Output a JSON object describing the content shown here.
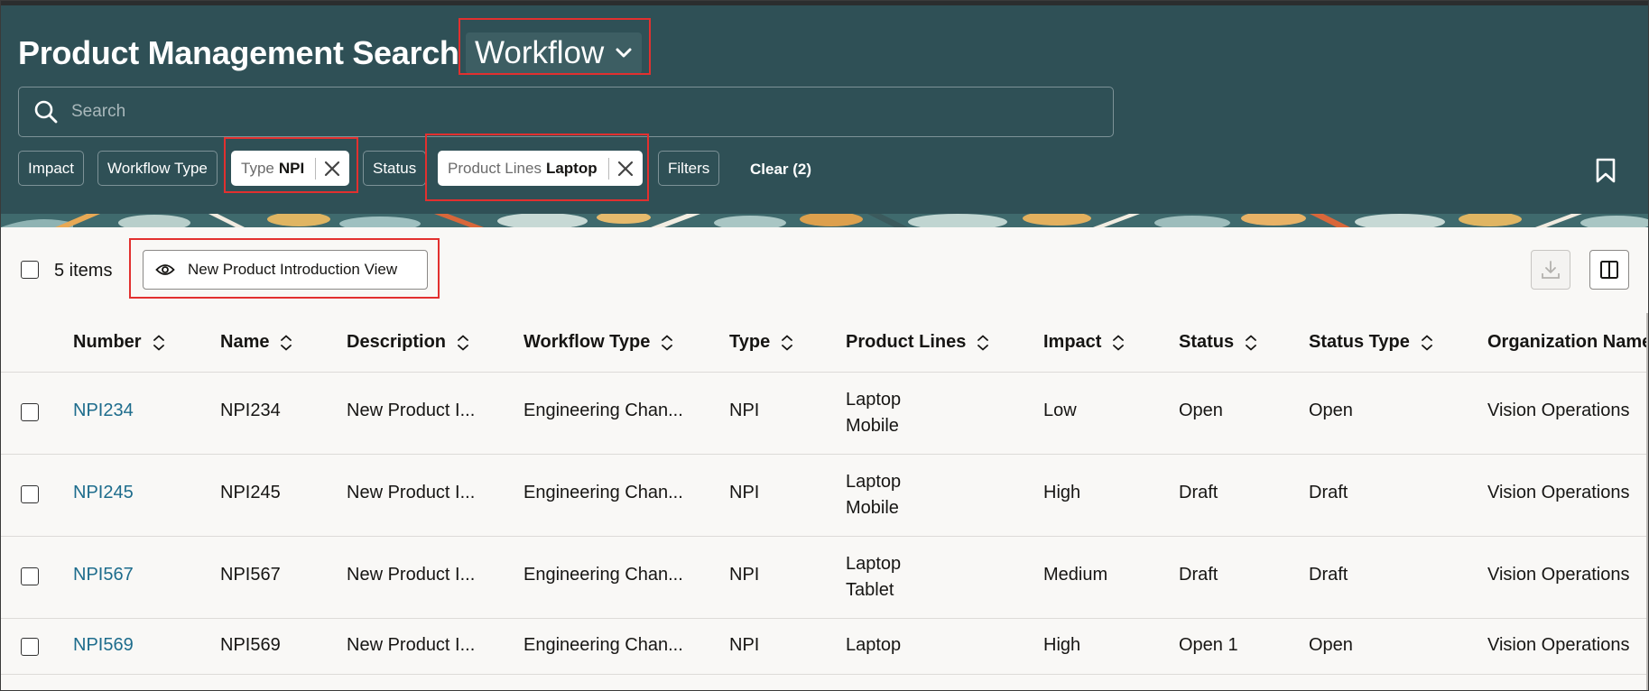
{
  "header": {
    "title": "Product Management Search",
    "object_selector": "Workflow",
    "search_placeholder": "Search",
    "filters": [
      {
        "label": "Impact"
      },
      {
        "label": "Workflow Type"
      },
      {
        "label": "Type",
        "value": "NPI"
      },
      {
        "label": "Status"
      },
      {
        "label": "Product Lines",
        "value": "Laptop"
      },
      {
        "label": "Filters"
      }
    ],
    "clear_label": "Clear (2)"
  },
  "toolbar": {
    "item_count": "5 items",
    "view_label": "New Product Introduction View"
  },
  "table": {
    "columns": [
      "Number",
      "Name",
      "Description",
      "Workflow Type",
      "Type",
      "Product Lines",
      "Impact",
      "Status",
      "Status Type",
      "Organization Name"
    ],
    "rows": [
      {
        "number": "NPI234",
        "name": "NPI234",
        "description": "New Product I...",
        "workflow_type": "Engineering Chan...",
        "type": "NPI",
        "product_lines": [
          "Laptop",
          "Mobile"
        ],
        "impact": "Low",
        "status": "Open",
        "status_type": "Open",
        "organization": "Vision Operations"
      },
      {
        "number": "NPI245",
        "name": "NPI245",
        "description": "New Product I...",
        "workflow_type": "Engineering Chan...",
        "type": "NPI",
        "product_lines": [
          "Laptop",
          "Mobile"
        ],
        "impact": "High",
        "status": "Draft",
        "status_type": "Draft",
        "organization": "Vision Operations"
      },
      {
        "number": "NPI567",
        "name": "NPI567",
        "description": "New Product I...",
        "workflow_type": "Engineering Chan...",
        "type": "NPI",
        "product_lines": [
          "Laptop",
          "Tablet"
        ],
        "impact": "Medium",
        "status": "Draft",
        "status_type": "Draft",
        "organization": "Vision Operations"
      },
      {
        "number": "NPI569",
        "name": "NPI569",
        "description": "New Product I...",
        "workflow_type": "Engineering Chan...",
        "type": "NPI",
        "product_lines": [
          "Laptop"
        ],
        "impact": "High",
        "status": "Open 1",
        "status_type": "Open",
        "organization": "Vision Operations"
      }
    ]
  },
  "colors": {
    "header_bg": "#2f5056",
    "link": "#1d6c8c",
    "highlight": "#e2302f",
    "page_bg": "#f9f8f6"
  },
  "icons": [
    "search-icon",
    "chevron-down-icon",
    "close-icon",
    "bookmark-icon",
    "eye-icon",
    "download-icon",
    "columns-icon",
    "sort-icon"
  ]
}
